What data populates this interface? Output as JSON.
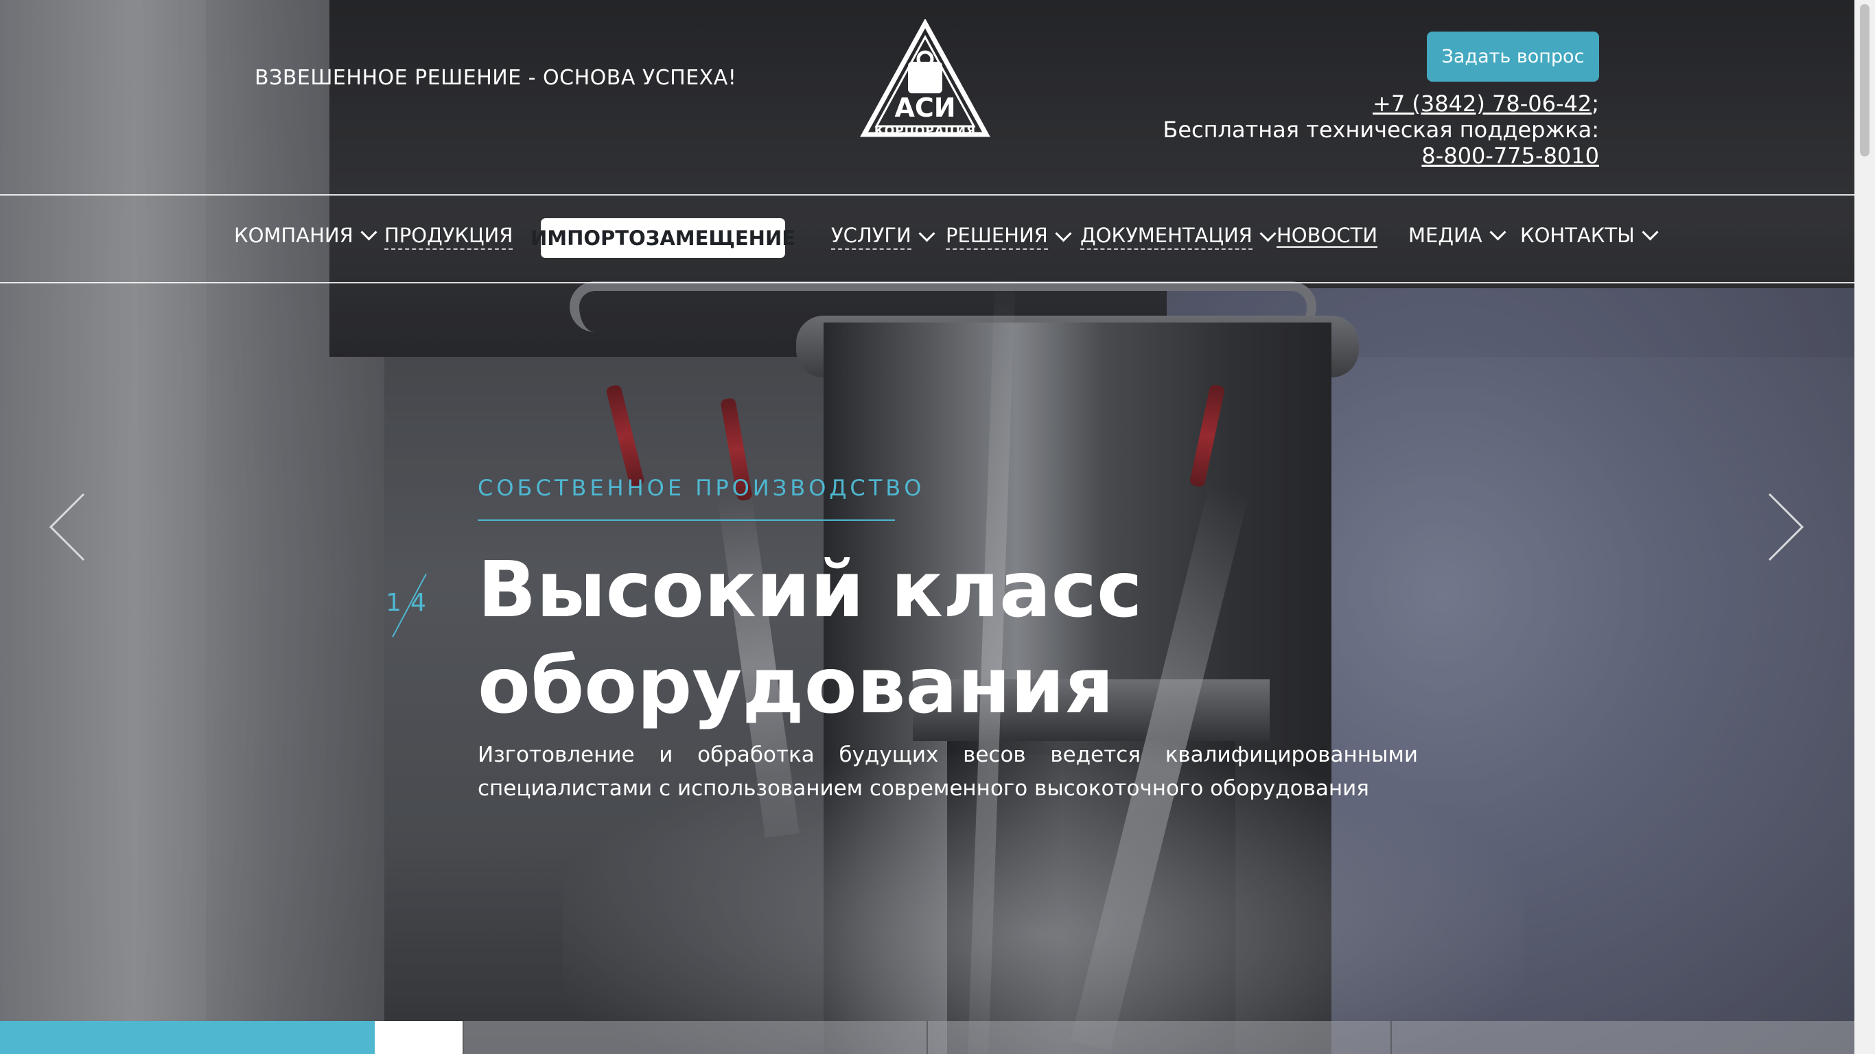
{
  "header": {
    "slogan": "ВЗВЕШЕННОЕ РЕШЕНИЕ - ОСНОВА УСПЕХА!",
    "logo": {
      "abbr": "АСИ",
      "word": "КОРПОРАЦИЯ"
    },
    "ask_button": "Задать вопрос",
    "phone": "+7 (3842) 78-06-42",
    "phone_suffix": ";",
    "support_label": "Бесплатная техническая поддержка:",
    "support_phone": "8-800-775-8010"
  },
  "nav": {
    "items": [
      {
        "label": "КОМПАНИЯ"
      },
      {
        "label": "ПРОДУКЦИЯ"
      },
      {
        "label": "ИМПОРТОЗАМЕЩЕНИЕ"
      },
      {
        "label": "УСЛУГИ"
      },
      {
        "label": "РЕШЕНИЯ"
      },
      {
        "label": "ДОКУМЕНТАЦИЯ"
      },
      {
        "label": "НОВОСТИ"
      },
      {
        "label": "МЕДИА"
      },
      {
        "label": "КОНТАКТЫ"
      }
    ]
  },
  "slide": {
    "eyebrow": "СОБСТВЕННОЕ ПРОИЗВОДСТВО",
    "current": "1",
    "total": "4",
    "title_line1": "Высокий класс",
    "title_line2": "оборудования",
    "text": "Изготовление и обработка будущих весов ведется квалифицированными специалистами с использованием современного высокоточного оборудования"
  },
  "colors": {
    "accent": "#4fb7d0",
    "button": "#44a9c0"
  },
  "icons": {
    "prev": "chevron-left-icon",
    "next": "chevron-right-icon",
    "dropdown": "chevron-down-icon"
  }
}
